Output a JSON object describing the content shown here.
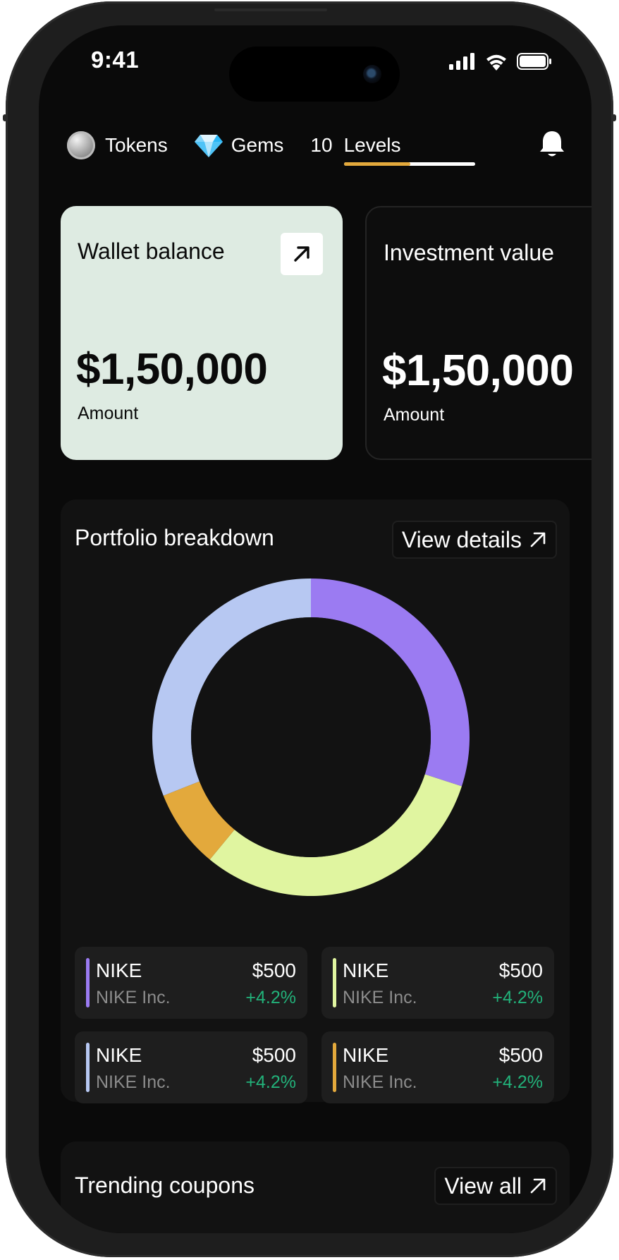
{
  "status_bar": {
    "time": "9:41"
  },
  "topbar": {
    "tokens_label": "Tokens",
    "gems_label": "Gems",
    "level_number": "10",
    "levels_label": "Levels",
    "level_progress": 0.51
  },
  "cards": [
    {
      "title": "Wallet balance",
      "amount": "$1,50,000",
      "subtitle": "Amount"
    },
    {
      "title": "Investment value",
      "amount": "$1,50,000",
      "subtitle": "Amount"
    }
  ],
  "portfolio": {
    "title": "Portfolio breakdown",
    "action_label": "View details",
    "holdings": [
      {
        "name": "NIKE",
        "company": "NIKE Inc.",
        "price": "$500",
        "change": "+4.2%",
        "color": "#9b7bf2"
      },
      {
        "name": "NIKE",
        "company": "NIKE Inc.",
        "price": "$500",
        "change": "+4.2%",
        "color": "#e0f5a0"
      },
      {
        "name": "NIKE",
        "company": "NIKE Inc.",
        "price": "$500",
        "change": "+4.2%",
        "color": "#b7c8f2"
      },
      {
        "name": "NIKE",
        "company": "NIKE Inc.",
        "price": "$500",
        "change": "+4.2%",
        "color": "#e3a93c"
      }
    ]
  },
  "chart_data": {
    "type": "pie",
    "title": "",
    "series": [
      {
        "color": "#9b7bf2",
        "value": 30
      },
      {
        "color": "#e0f5a0",
        "value": 31
      },
      {
        "color": "#e3a93c",
        "value": 8
      },
      {
        "color": "#b7c8f2",
        "value": 31
      }
    ],
    "hole": "donut"
  },
  "coupons": {
    "title": "Trending coupons",
    "action_label": "View all"
  }
}
